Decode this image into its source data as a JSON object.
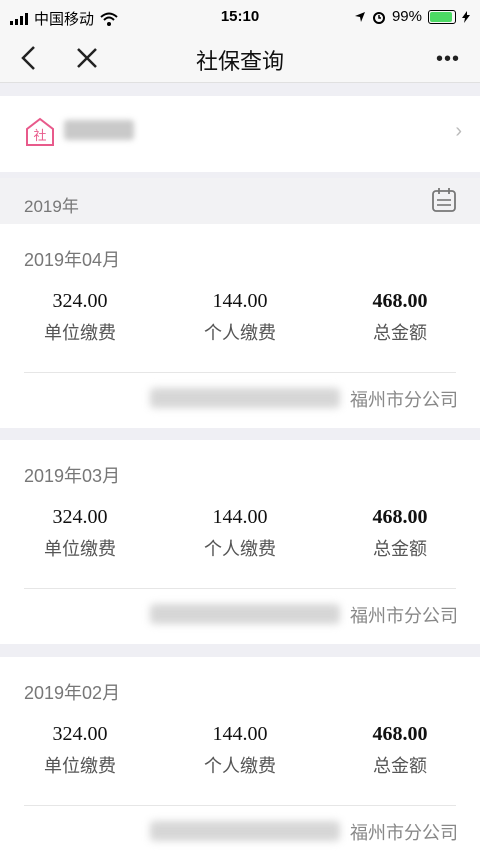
{
  "status_bar": {
    "carrier": "中国移动",
    "time": "15:10",
    "battery_percent": "99%",
    "battery_level": 0.99
  },
  "nav": {
    "title": "社保查询",
    "more": "•••"
  },
  "user_card": {
    "icon_text": "社",
    "chevron": "›"
  },
  "year": "2019年",
  "months": [
    {
      "label": "2019年04月",
      "unit_amount": "324.00",
      "unit_label": "单位缴费",
      "personal_amount": "144.00",
      "personal_label": "个人缴费",
      "total_amount": "468.00",
      "total_label": "总金额",
      "company": "福州市分公司"
    },
    {
      "label": "2019年03月",
      "unit_amount": "324.00",
      "unit_label": "单位缴费",
      "personal_amount": "144.00",
      "personal_label": "个人缴费",
      "total_amount": "468.00",
      "total_label": "总金额",
      "company": "福州市分公司"
    },
    {
      "label": "2019年02月",
      "unit_amount": "324.00",
      "unit_label": "单位缴费",
      "personal_amount": "144.00",
      "personal_label": "个人缴费",
      "total_amount": "468.00",
      "total_label": "总金额",
      "company": "福州市分公司"
    }
  ],
  "colors": {
    "accent_pink": "#e85a8b",
    "battery_green": "#4cd964"
  }
}
